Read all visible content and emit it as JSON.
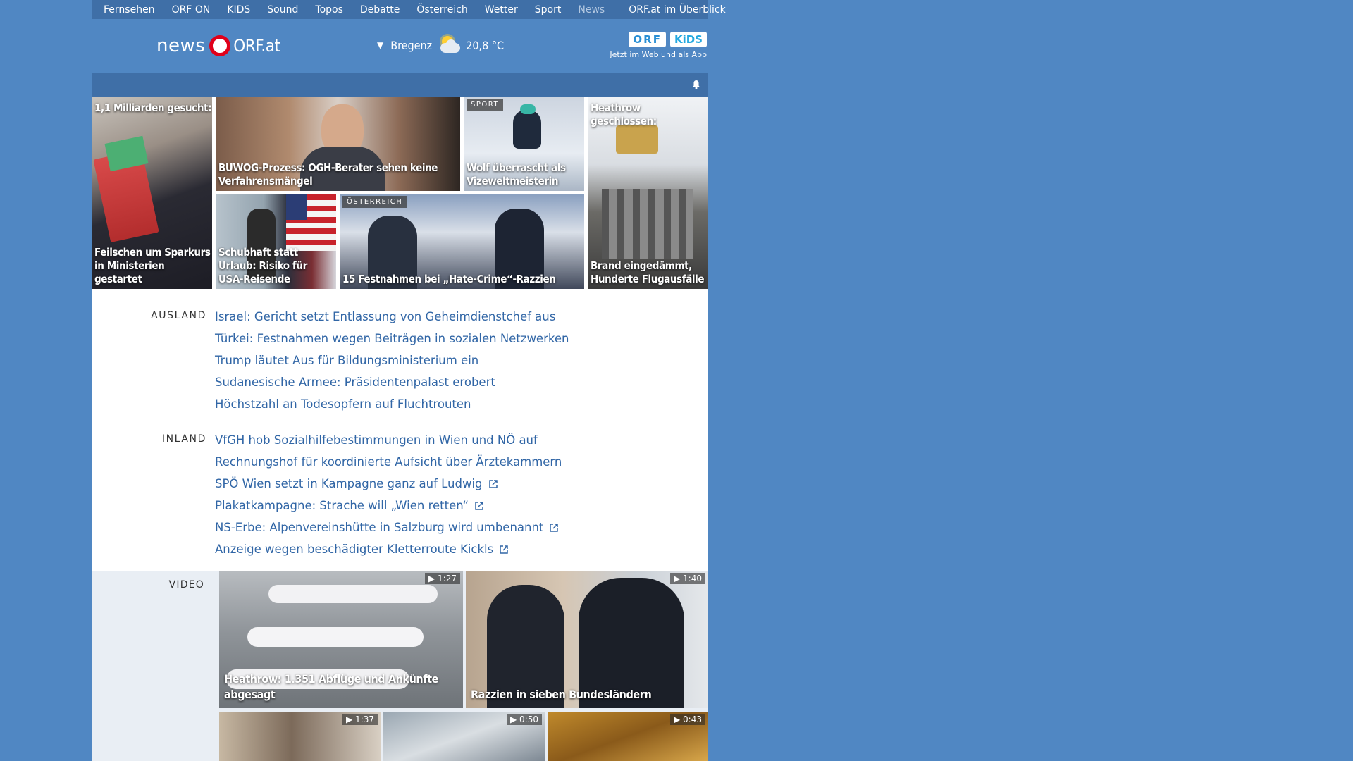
{
  "nav": {
    "items": [
      "Fernsehen",
      "ORF ON",
      "KIDS",
      "Sound",
      "Topos",
      "Debatte",
      "Österreich",
      "Wetter",
      "Sport",
      "News"
    ],
    "active": "News",
    "overview": "ORF.at im Überblick"
  },
  "header": {
    "logo_news": "news",
    "logo_orf": "ORF.at",
    "weather": {
      "city": "Bregenz",
      "temp": "20,8 °C",
      "icon": "partly-cloudy-icon"
    },
    "kids": {
      "badge1": "ORF",
      "badge2": "KiDS",
      "tagline": "Jetzt im Web und als App"
    }
  },
  "teasers": [
    {
      "caption_top": "1,1 Milliarden gesucht:",
      "caption": "Feilschen um Sparkurs in Ministerien gestartet",
      "badge": ""
    },
    {
      "caption": "BUWOG-Prozess: OGH-Berater sehen keine Verfahrensmängel",
      "badge": ""
    },
    {
      "caption": "Wolf überrascht als Vizeweltmeisterin",
      "badge": "SPORT"
    },
    {
      "caption_top": "Heathrow geschlossen:",
      "caption": "Brand eingedämmt, Hunderte Flugausfälle",
      "badge": ""
    },
    {
      "caption": "Schubhaft statt Urlaub: Risiko für USA-Reisende",
      "badge": ""
    },
    {
      "caption": "15 Festnahmen bei „Hate-Crime“-Razzien",
      "badge": "ÖSTERREICH"
    }
  ],
  "ausland": {
    "label": "AUSLAND",
    "items": [
      "Israel: Gericht setzt Entlassung von Geheimdienstchef aus",
      "Türkei: Festnahmen wegen Beiträgen in sozialen Netzwerken",
      "Trump läutet Aus für Bildungsministerium ein",
      "Sudanesische Armee: Präsidentenpalast erobert",
      "Höchstzahl an Todesopfern auf Fluchtrouten"
    ]
  },
  "inland": {
    "label": "INLAND",
    "items": [
      "VfGH hob Sozialhilfebestimmungen in Wien und NÖ auf",
      "Rechnungshof für koordinierte Aufsicht über Ärztekammern",
      "SPÖ Wien setzt in Kampagne ganz auf Ludwig",
      "Plakatkampagne: Strache will „Wien retten“",
      "NS-Erbe: Alpenvereinshütte in Salzburg wird umbenannt",
      "Anzeige wegen beschädigter Kletterroute Kickls"
    ],
    "external": [
      false,
      false,
      true,
      true,
      true,
      true
    ]
  },
  "video": {
    "label": "VIDEO",
    "items": [
      {
        "duration": "1:27",
        "caption": "Heathrow: 1.351 Abflüge und Ankünfte abgesagt"
      },
      {
        "duration": "1:40",
        "caption": "Razzien in sieben Bundesländern"
      },
      {
        "duration": "1:37",
        "caption": ""
      },
      {
        "duration": "0:50",
        "caption": ""
      },
      {
        "duration": "0:43",
        "caption": ""
      }
    ]
  }
}
